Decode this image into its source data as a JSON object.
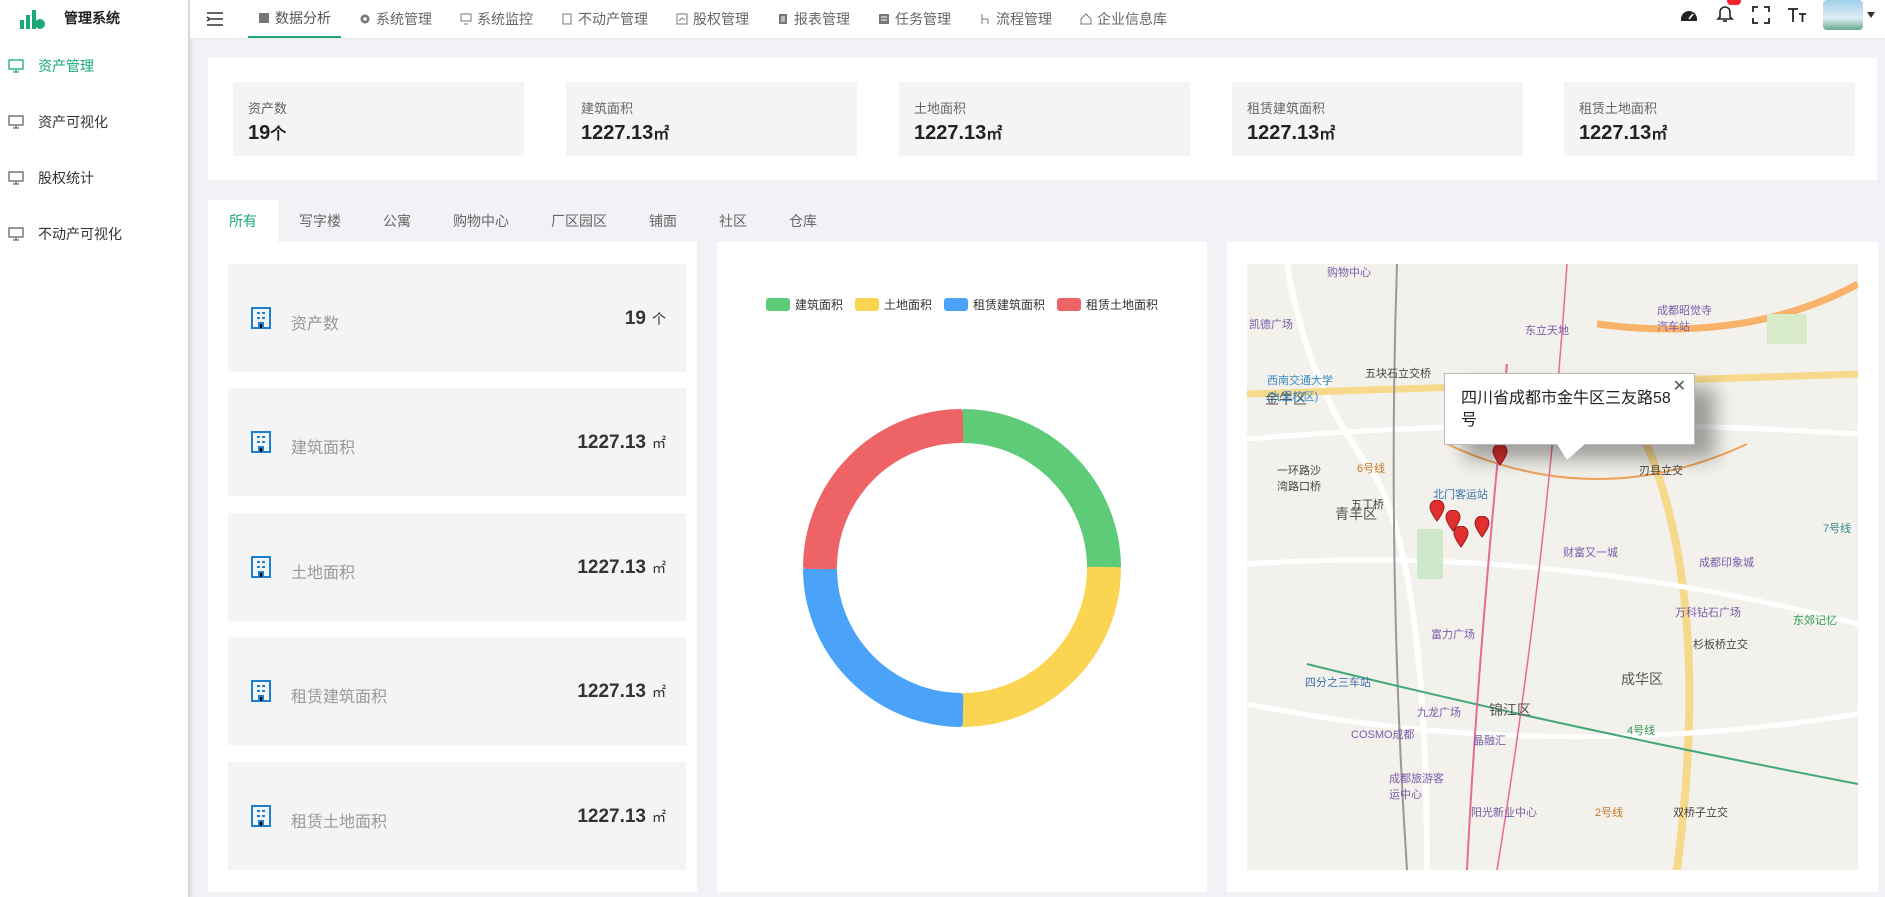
{
  "app": {
    "title": "管理系统"
  },
  "sidebar": {
    "items": [
      {
        "label": "资产管理",
        "active": true
      },
      {
        "label": "资产可视化",
        "active": false
      },
      {
        "label": "股权统计",
        "active": false
      },
      {
        "label": "不动产可视化",
        "active": false
      }
    ]
  },
  "topnav": {
    "items": [
      {
        "label": "数据分析",
        "active": true
      },
      {
        "label": "系统管理"
      },
      {
        "label": "系统监控"
      },
      {
        "label": "不动产管理"
      },
      {
        "label": "股权管理"
      },
      {
        "label": "报表管理"
      },
      {
        "label": "任务管理"
      },
      {
        "label": "流程管理"
      },
      {
        "label": "企业信息库"
      }
    ]
  },
  "stats": [
    {
      "label": "资产数",
      "value": "19",
      "unit": "个"
    },
    {
      "label": "建筑面积",
      "value": "1227.13",
      "unit": "㎡"
    },
    {
      "label": "土地面积",
      "value": "1227.13",
      "unit": "㎡"
    },
    {
      "label": "租赁建筑面积",
      "value": "1227.13",
      "unit": "㎡"
    },
    {
      "label": "租赁土地面积",
      "value": "1227.13",
      "unit": "㎡"
    }
  ],
  "tabs": [
    "所有",
    "写字楼",
    "公寓",
    "购物中心",
    "厂区园区",
    "铺面",
    "社区",
    "仓库"
  ],
  "metrics": [
    {
      "label": "资产数",
      "value": "19",
      "unit": "个"
    },
    {
      "label": "建筑面积",
      "value": "1227.13",
      "unit": "㎡"
    },
    {
      "label": "土地面积",
      "value": "1227.13",
      "unit": "㎡"
    },
    {
      "label": "租赁建筑面积",
      "value": "1227.13",
      "unit": "㎡"
    },
    {
      "label": "租赁土地面积",
      "value": "1227.13",
      "unit": "㎡"
    }
  ],
  "chart_data": {
    "type": "pie",
    "legend": "top",
    "categories": [
      "建筑面积",
      "土地面积",
      "租赁建筑面积",
      "租赁土地面积"
    ],
    "values": [
      1227.13,
      1227.13,
      1227.13,
      1227.13
    ],
    "colors": [
      "#5ecb78",
      "#fbd451",
      "#4aa3f8",
      "#ee6466"
    ]
  },
  "map": {
    "popup_text": "四川省成都市金牛区三友路58号",
    "close_glyph": "✕",
    "labels": [
      "金牛区",
      "青羊区",
      "成华区",
      "锦江区"
    ],
    "pois": [
      "购物中心",
      "凯德广场",
      "东立天地",
      "成都昭觉寺汽车站",
      "西南交通大学(九里校区)",
      "五块石立交桥",
      "一环路沙湾路口桥",
      "五丁桥",
      "北门客运站",
      "刃县立交",
      "财富又一城",
      "成都印象城",
      "万科钻石广场",
      "东郊记忆",
      "富力广场",
      "四分之三车站",
      "九龙广场",
      "COSMO成都",
      "晶融汇",
      "成都旅游客运中心",
      "阳光新业中心",
      "双桥子立交",
      "杉板桥立交",
      "6号线",
      "7号线",
      "4号线",
      "2号线"
    ]
  },
  "icons": {
    "menu": "menu-fold-icon",
    "dashboard": "dashboard-icon",
    "bell": "bell-icon",
    "fullscreen": "fullscreen-icon",
    "font_size": "font-size-icon"
  }
}
